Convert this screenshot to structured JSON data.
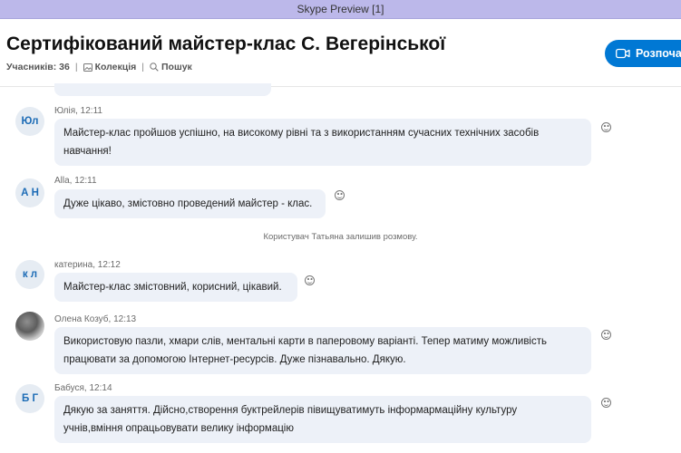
{
  "window": {
    "title": "Skype Preview [1]"
  },
  "header": {
    "title": "Сертифікований майстер-клас С. Вегерінської",
    "participants": "Учасників: 36",
    "collection": "Колекція",
    "search": "Пошук",
    "start_button": "Розпоча"
  },
  "messages": [
    {
      "initials": "Юл",
      "sender": "Юлія, 12:11",
      "lines": [
        "Майстер-клас пройшов успішно, на високому рівні та з використанням сучасних технічних засобів",
        "навчання!"
      ]
    },
    {
      "initials": "А Н",
      "sender": "Alla, 12:11",
      "lines": [
        "Дуже цікаво, змістовно проведений майстер - клас."
      ]
    },
    {
      "initials": "к л",
      "sender": "катерина, 12:12",
      "lines": [
        "Майстер-клас змістовний, корисний, цікавий."
      ]
    },
    {
      "initials": "",
      "sender": "Олена Козуб, 12:13",
      "lines": [
        "Використовую пазли, хмари слів, ментальні карти в паперовому варіанті. Тепер матиму можливість",
        "працювати за допомогою Інтернет-ресурсів. Дуже пізнавально. Дякую."
      ]
    },
    {
      "initials": "Б Г",
      "sender": "Бабуся, 12:14",
      "lines": [
        "Дякую за заняття. Дійсно,створення буктрейлерів півищуватимуть інформармаційну культуру",
        "учнів,вміння опрацьовувати велику інформацію"
      ]
    }
  ],
  "system_message": "Користувач Татьяна залишив розмову.",
  "icons": {
    "collection": "gallery-icon",
    "search": "search-icon",
    "start": "video-call-icon",
    "reaction": "smiley-icon"
  },
  "colors": {
    "accent": "#0078d4",
    "bubble": "#edf1f8",
    "titlebar": "#bcb8ea",
    "avatar_text": "#1d6cb6"
  }
}
